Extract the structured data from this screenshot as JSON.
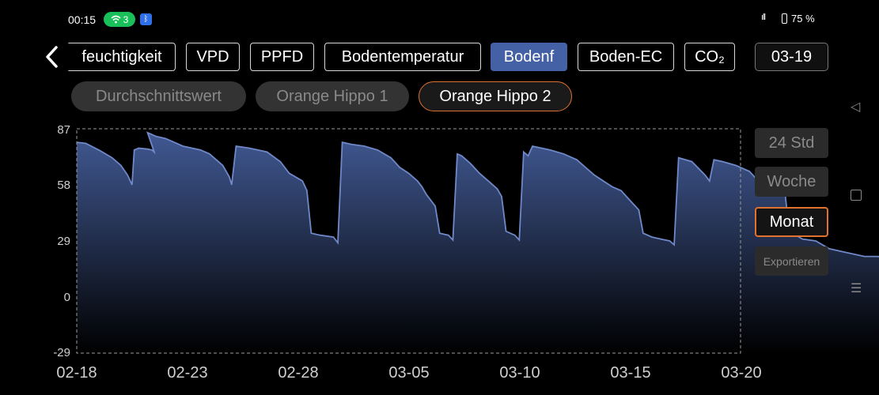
{
  "status_bar": {
    "time": "00:15",
    "wifi_count": "3",
    "battery": "75 %"
  },
  "tabs": [
    {
      "label": "feuchtigkeit",
      "active": false
    },
    {
      "label": "VPD",
      "active": false
    },
    {
      "label": "PPFD",
      "active": false
    },
    {
      "label": "Bodentemperatur",
      "active": false
    },
    {
      "label": "Bodenf",
      "active": true
    },
    {
      "label": "Boden-EC",
      "active": false
    },
    {
      "label": "CO₂",
      "active": false
    }
  ],
  "date_button": "03-19",
  "sensors": [
    {
      "label": "Durchschnittswert",
      "active": false
    },
    {
      "label": "Orange Hippo 1",
      "active": false
    },
    {
      "label": "Orange Hippo 2",
      "active": true
    }
  ],
  "range_buttons": [
    {
      "label": "24 Std",
      "active": false
    },
    {
      "label": "Woche",
      "active": false
    },
    {
      "label": "Monat",
      "active": true
    }
  ],
  "export_label": "Exportieren",
  "chart_data": {
    "type": "area",
    "title": "",
    "xlabel": "",
    "ylabel": "",
    "ylim": [
      -29,
      87
    ],
    "y_ticks": [
      "87",
      "58",
      "29",
      "0",
      "-29"
    ],
    "x_ticks": [
      "02-18",
      "02-23",
      "02-28",
      "03-05",
      "03-10",
      "03-15",
      "03-20"
    ],
    "x_range_days": [
      0,
      30
    ],
    "grid": false,
    "colors": {
      "line": "#6f88c8",
      "fill_top": "#415993",
      "fill_bottom": "#000000",
      "frame": "#9a9a9a"
    },
    "series": [
      {
        "points": [
          [
            0.0,
            80
          ],
          [
            0.4,
            79.5
          ],
          [
            1.0,
            76
          ],
          [
            1.6,
            72
          ],
          [
            2.0,
            68
          ],
          [
            2.3,
            63
          ],
          [
            2.5,
            58
          ],
          [
            2.6,
            76
          ],
          [
            2.8,
            77
          ],
          [
            3.2,
            76.5
          ],
          [
            3.4,
            76
          ],
          [
            3.5,
            75
          ],
          [
            3.2,
            85
          ],
          [
            3.6,
            83
          ],
          [
            4.0,
            82
          ],
          [
            4.4,
            80
          ],
          [
            4.8,
            78
          ],
          [
            5.6,
            76
          ],
          [
            6.0,
            74
          ],
          [
            6.6,
            68
          ],
          [
            6.9,
            62
          ],
          [
            7.0,
            58
          ],
          [
            7.2,
            78
          ],
          [
            7.8,
            77
          ],
          [
            8.6,
            75
          ],
          [
            9.2,
            70
          ],
          [
            9.6,
            64
          ],
          [
            10.2,
            60
          ],
          [
            10.4,
            55
          ],
          [
            10.6,
            33
          ],
          [
            11.0,
            32
          ],
          [
            11.6,
            31
          ],
          [
            11.8,
            28
          ],
          [
            12.0,
            80
          ],
          [
            12.4,
            79
          ],
          [
            13.0,
            78
          ],
          [
            13.6,
            76
          ],
          [
            14.2,
            72
          ],
          [
            14.6,
            67
          ],
          [
            15.0,
            64
          ],
          [
            15.4,
            60
          ],
          [
            15.6,
            57
          ],
          [
            15.8,
            53
          ],
          [
            16.0,
            50
          ],
          [
            16.2,
            47
          ],
          [
            16.4,
            33
          ],
          [
            16.8,
            32
          ],
          [
            17.0,
            29.5
          ],
          [
            17.2,
            74
          ],
          [
            17.4,
            73
          ],
          [
            17.8,
            69
          ],
          [
            18.2,
            64
          ],
          [
            18.6,
            60
          ],
          [
            19.0,
            56
          ],
          [
            19.2,
            52
          ],
          [
            19.4,
            34
          ],
          [
            19.8,
            32
          ],
          [
            20.0,
            29.5
          ],
          [
            20.2,
            75
          ],
          [
            20.4,
            73
          ],
          [
            20.6,
            78
          ],
          [
            20.8,
            77.5
          ],
          [
            21.4,
            76
          ],
          [
            22.0,
            74
          ],
          [
            22.6,
            71
          ],
          [
            23.0,
            67
          ],
          [
            23.4,
            63
          ],
          [
            23.8,
            60
          ],
          [
            24.2,
            57
          ],
          [
            24.6,
            55
          ],
          [
            25.0,
            50
          ],
          [
            25.4,
            45
          ],
          [
            25.6,
            33
          ],
          [
            26.0,
            31
          ],
          [
            26.4,
            30
          ],
          [
            26.8,
            29
          ],
          [
            27.0,
            27
          ],
          [
            27.2,
            72
          ],
          [
            27.8,
            70
          ],
          [
            28.4,
            63
          ],
          [
            28.6,
            60
          ],
          [
            28.8,
            71
          ],
          [
            29.2,
            70
          ],
          [
            29.8,
            68
          ],
          [
            30.4,
            65
          ],
          [
            30.8,
            60
          ],
          [
            31.0,
            58
          ],
          [
            31.6,
            56
          ],
          [
            32.0,
            55
          ],
          [
            32.2,
            34
          ],
          [
            32.8,
            30
          ],
          [
            33.4,
            29
          ],
          [
            34.0,
            25
          ],
          [
            34.8,
            23
          ],
          [
            35.6,
            21
          ],
          [
            36.2,
            21
          ],
          [
            36.8,
            20
          ],
          [
            37.0,
            12
          ],
          [
            37.2,
            0
          ]
        ]
      }
    ]
  }
}
